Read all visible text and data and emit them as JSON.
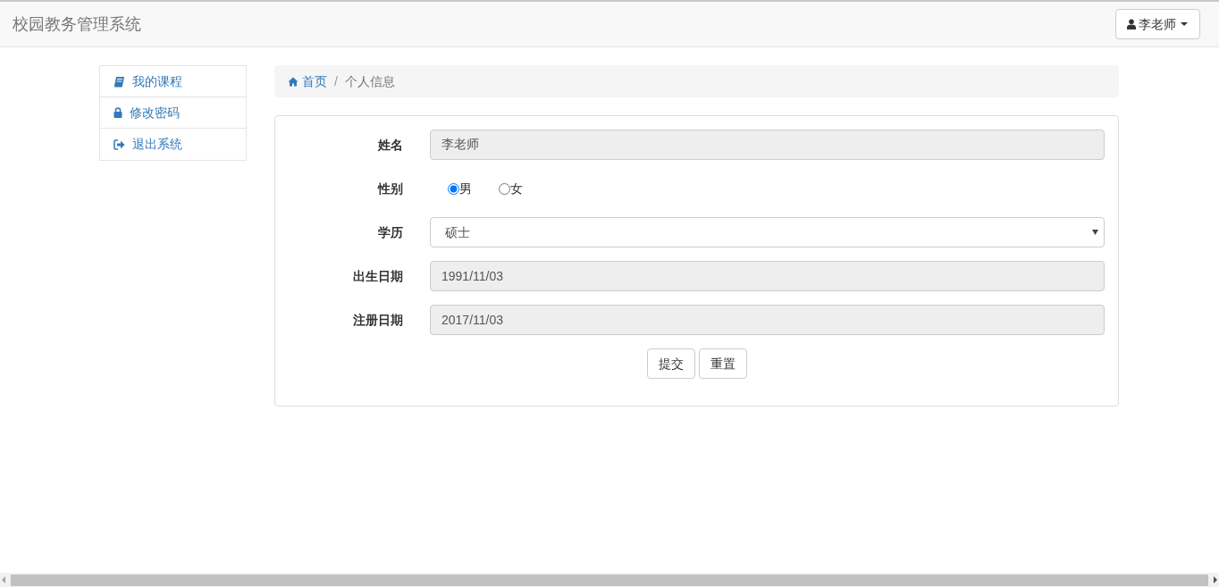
{
  "navbar": {
    "brand": "校园教务管理系统",
    "user_menu": "李老师"
  },
  "sidebar": {
    "items": [
      {
        "label": "我的课程"
      },
      {
        "label": "修改密码"
      },
      {
        "label": "退出系统"
      }
    ]
  },
  "breadcrumb": {
    "separator": "/",
    "items": [
      {
        "label": "首页"
      },
      {
        "label": "个人信息"
      }
    ]
  },
  "form": {
    "fields": [
      {
        "kind": "text",
        "label": "姓名",
        "value": "李老师",
        "disabled": true
      },
      {
        "kind": "radio",
        "label": "性别",
        "options": [
          {
            "label": "男",
            "selected": true
          },
          {
            "label": "女",
            "selected": false
          }
        ]
      },
      {
        "kind": "select",
        "label": "学历",
        "value": "硕士"
      },
      {
        "kind": "text",
        "label": "出生日期",
        "value": "1991/11/03",
        "disabled": true
      },
      {
        "kind": "text",
        "label": "注册日期",
        "value": "2017/11/03",
        "disabled": true
      }
    ],
    "buttons": [
      "提交",
      "重置"
    ]
  }
}
